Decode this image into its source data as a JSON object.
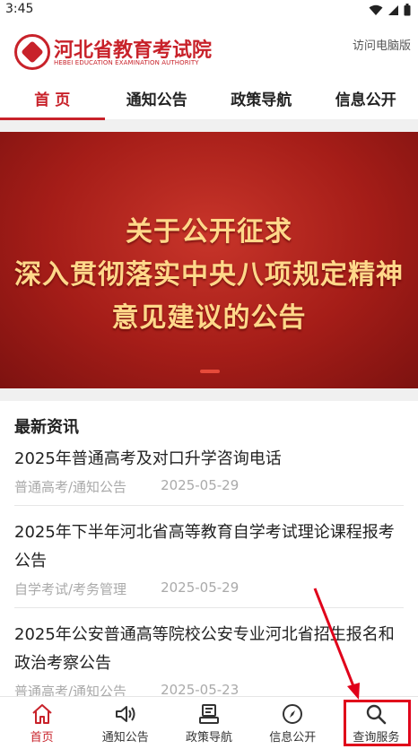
{
  "status_bar": {
    "time": "3:45"
  },
  "header": {
    "logo_cn": "河北省教育考试院",
    "logo_en": "HEBEI EDUCATION EXAMINATION AUTHORITY",
    "pc_link": "访问电脑版"
  },
  "nav": {
    "tabs": [
      {
        "label": "首 页",
        "active": true
      },
      {
        "label": "通知公告"
      },
      {
        "label": "政策导航"
      },
      {
        "label": "信息公开"
      }
    ]
  },
  "banner": {
    "lines": [
      "关于公开征求",
      "深入贯彻落实中央八项规定精神",
      "意见建议的公告"
    ]
  },
  "news": {
    "title": "最新资讯",
    "items": [
      {
        "headline": "2025年普通高考及对口升学咨询电话",
        "category": "普通高考/通知公告",
        "date": "2025-05-29"
      },
      {
        "headline": "2025年下半年河北省高等教育自学考试理论课程报考公告",
        "category": "自学考试/考务管理",
        "date": "2025-05-29"
      },
      {
        "headline": "2025年公安普通高等院校公安专业河北省招生报名和政治考察公告",
        "category": "普通高考/通知公告",
        "date": "2025-05-23"
      }
    ]
  },
  "tabbar": {
    "items": [
      {
        "label": "首页",
        "icon": "home-icon",
        "active": true
      },
      {
        "label": "通知公告",
        "icon": "speaker-icon"
      },
      {
        "label": "政策导航",
        "icon": "policy-icon"
      },
      {
        "label": "信息公开",
        "icon": "compass-icon"
      },
      {
        "label": "查询服务",
        "icon": "search-icon"
      }
    ]
  },
  "colors": {
    "brand": "#c8222a",
    "highlight": "#e0001a"
  }
}
